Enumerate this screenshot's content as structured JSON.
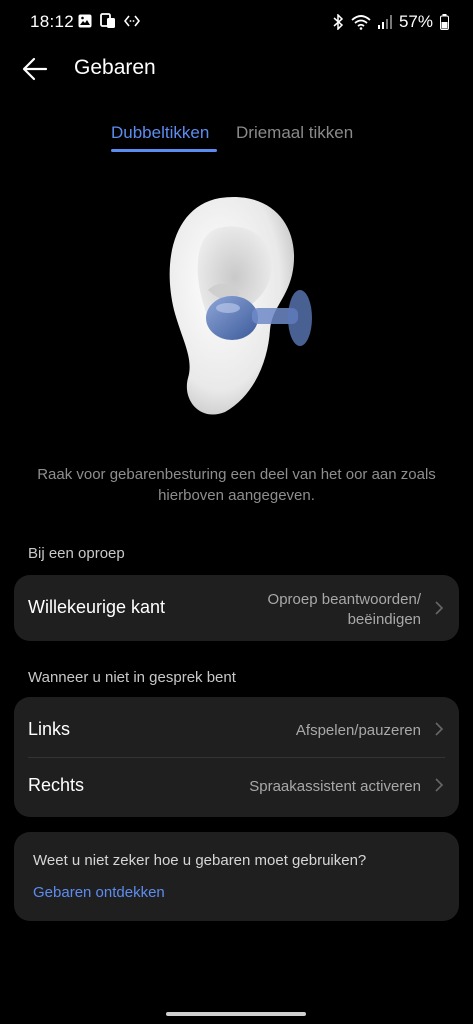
{
  "status_bar": {
    "time": "18:12",
    "battery": "57%",
    "icons": [
      "gallery-icon",
      "cast-icon",
      "code-icon",
      "bluetooth-icon",
      "wifi-icon",
      "signal-icon",
      "battery-icon"
    ]
  },
  "header": {
    "title": "Gebaren",
    "back_icon": "back-arrow-icon"
  },
  "tabs": [
    {
      "label": "Dubbeltikken",
      "active": true
    },
    {
      "label": "Driemaal tikken",
      "active": false
    }
  ],
  "hint": "Raak voor gebarenbesturing een deel van het oor aan zoals hierboven aangegeven.",
  "section_call": {
    "label": "Bij een oproep",
    "rows": [
      {
        "title": "Willekeurige kant",
        "value_line1": "Oproep beantwoorden/",
        "value_line2": "beëindigen"
      }
    ]
  },
  "section_idle": {
    "label": "Wanneer u niet in gesprek bent",
    "rows": [
      {
        "title": "Links",
        "value": "Afspelen/pauzeren"
      },
      {
        "title": "Rechts",
        "value": "Spraakassistent activeren"
      }
    ]
  },
  "help_card": {
    "question": "Weet u niet zeker hoe u gebaren moet gebruiken?",
    "link": "Gebaren ontdekken"
  },
  "colors": {
    "accent": "#5d8cf0",
    "card": "#1f1f1f",
    "background": "#000000"
  }
}
